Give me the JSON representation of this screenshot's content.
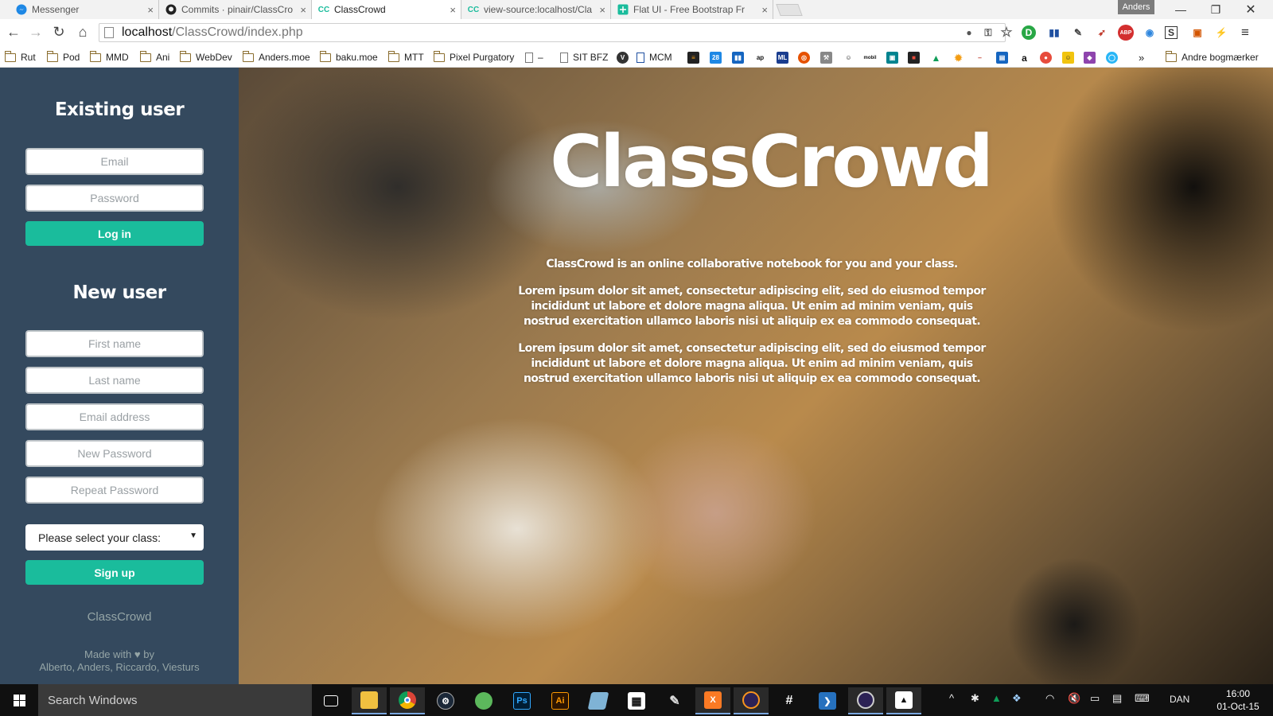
{
  "browser": {
    "tabs": [
      {
        "title": "Messenger",
        "icon": "messenger-icon",
        "color": "#1e88e5",
        "active": false
      },
      {
        "title": "Commits · pinair/ClassCro",
        "icon": "github-icon",
        "color": "#222222",
        "active": false
      },
      {
        "title": "ClassCrowd",
        "icon_text": "CC",
        "color": "#1abc9c",
        "active": true
      },
      {
        "title": "view-source:localhost/Cla",
        "icon_text": "CC",
        "color": "#1abc9c",
        "active": false
      },
      {
        "title": "Flat UI - Free Bootstrap Fr",
        "icon": "flatui-icon",
        "color": "#1abc9c",
        "active": false
      }
    ],
    "user": "Anders",
    "url_host": "localhost",
    "url_path": "/ClassCrowd/index.php",
    "bookmarks": [
      {
        "label": "Rut",
        "type": "folder"
      },
      {
        "label": "Pod",
        "type": "folder"
      },
      {
        "label": "MMD",
        "type": "folder"
      },
      {
        "label": "Ani",
        "type": "folder"
      },
      {
        "label": "WebDev",
        "type": "folder"
      },
      {
        "label": "Anders.moe",
        "type": "folder"
      },
      {
        "label": "baku.moe",
        "type": "folder"
      },
      {
        "label": "MTT",
        "type": "folder"
      },
      {
        "label": "Pixel Purgatory",
        "type": "folder"
      },
      {
        "label": "–",
        "type": "page"
      },
      {
        "label": "SIT BFZ",
        "type": "page"
      },
      {
        "label": "MCM",
        "type": "page"
      }
    ],
    "other_bookmarks": "Andre bogmærker",
    "overflow": "»"
  },
  "sidebar": {
    "existing_heading": "Existing user",
    "email_placeholder": "Email",
    "password_placeholder": "Password",
    "login_label": "Log in",
    "new_heading": "New user",
    "first_name_placeholder": "First name",
    "last_name_placeholder": "Last name",
    "email_address_placeholder": "Email address",
    "new_password_placeholder": "New Password",
    "repeat_password_placeholder": "Repeat Password",
    "class_select": "Please select your class:",
    "signup_label": "Sign up",
    "footer_brand": "ClassCrowd",
    "footer_made_prefix": "Made with",
    "footer_made_suffix": "by",
    "footer_authors": "Alberto, Anders, Riccardo, Viesturs"
  },
  "hero": {
    "title": "ClassCrowd",
    "tagline": "ClassCrowd is an online collaborative notebook for you and your class.",
    "paragraph1": "Lorem ipsum dolor sit amet, consectetur adipiscing elit, sed do eiusmod tempor incididunt ut labore et dolore magna aliqua. Ut enim ad minim veniam, quis nostrud exercitation ullamco laboris nisi ut aliquip ex ea commodo consequat.",
    "paragraph2": "Lorem ipsum dolor sit amet, consectetur adipiscing elit, sed do eiusmod tempor incididunt ut labore et dolore magna aliqua. Ut enim ad minim veniam, quis nostrud exercitation ullamco laboris nisi ut aliquip ex ea commodo consequat."
  },
  "taskbar": {
    "search_placeholder": "Search Windows",
    "language": "DAN",
    "time": "16:00",
    "date": "01-Oct-15"
  },
  "colors": {
    "sidebar_bg": "#34495e",
    "accent": "#1abc9c",
    "field_border": "#bdc3c7",
    "muted_text": "#95a5a6"
  }
}
